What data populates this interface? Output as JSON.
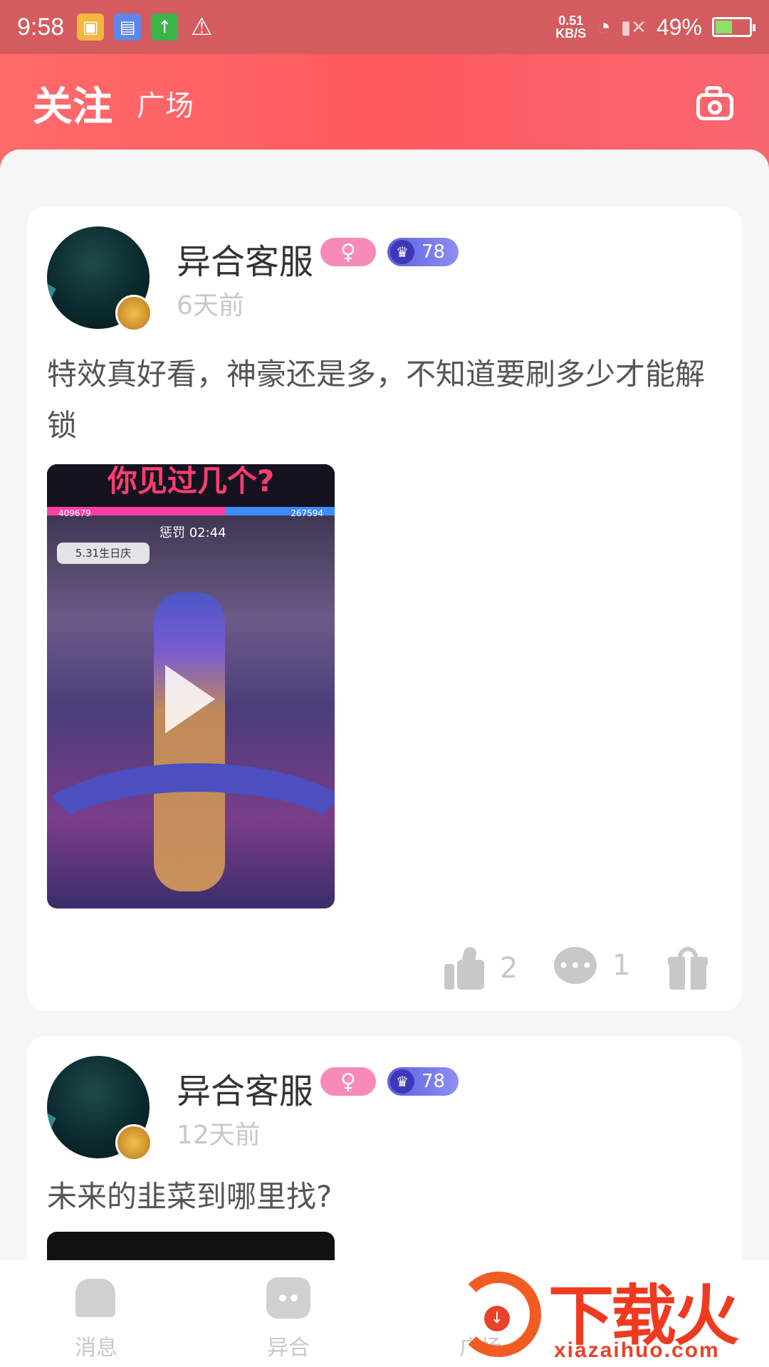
{
  "status_bar": {
    "time": "9:58",
    "net_speed_value": "0.51",
    "net_speed_unit": "KB/S",
    "battery": "49%",
    "battery_level": 0.49
  },
  "header": {
    "tab_active": "关注",
    "tab_inactive": "广场"
  },
  "posts": [
    {
      "username": "异合客服",
      "gender_symbol": "♀",
      "level": "78",
      "time_ago": "6天前",
      "text": "特效真好看，神豪还是多，不知道要刷多少才能解锁",
      "video": {
        "banner": "你见过几个?",
        "left_score": "409679",
        "right_score": "267594",
        "timer": "惩罚 02:44",
        "event": "5.31生日庆"
      },
      "likes": "2",
      "comments": "1"
    },
    {
      "username": "异合客服",
      "gender_symbol": "♀",
      "level": "78",
      "time_ago": "12天前",
      "text": "未来的韭菜到哪里找?"
    }
  ],
  "bottom_nav": {
    "items": [
      {
        "label": "消息"
      },
      {
        "label": "异合"
      },
      {
        "label": "广场"
      }
    ]
  },
  "watermark": {
    "title": "下载火",
    "url": "xiazaihuo.com"
  },
  "colors": {
    "header": "#ff5a5f",
    "gender_badge": "#f78ab8",
    "level_badge": "#5b5fe0",
    "watermark": "#ef3a1f"
  }
}
